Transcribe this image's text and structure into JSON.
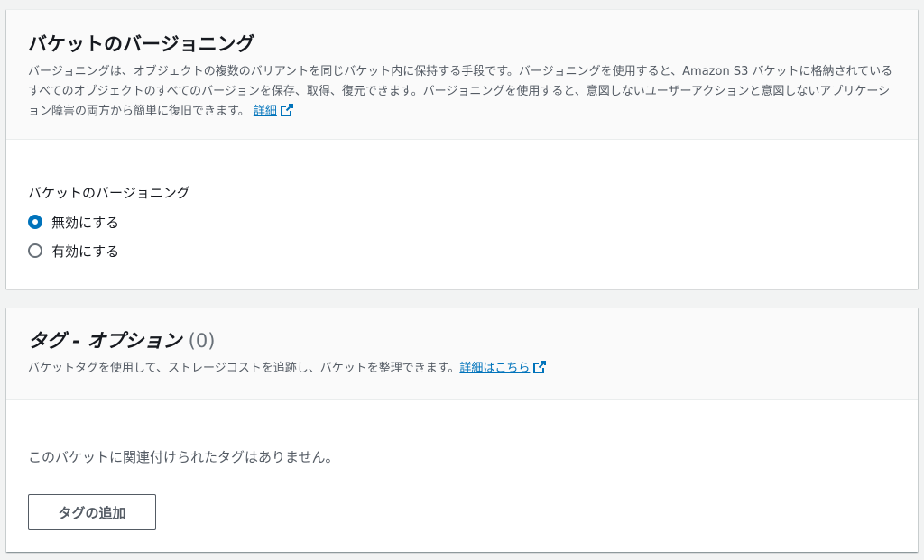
{
  "colors": {
    "link": "#0073bb",
    "radio_selected": "#0073bb",
    "page_background": "#f2f3f3",
    "header_background": "#fafafa"
  },
  "versioning": {
    "title": "バケットのバージョニング",
    "description": "バージョニングは、オブジェクトの複数のバリアントを同じバケット内に保持する手段です。バージョニングを使用すると、Amazon S3 バケットに格納されているすべてのオブジェクトのすべてのバージョンを保存、取得、復元できます。バージョニングを使用すると、意図しないユーザーアクションと意図しないアプリケーション障害の両方から簡単に復旧できます。",
    "learn_more": "詳細",
    "learn_more_icon": "external-link-icon",
    "field_label": "バケットのバージョニング",
    "options": [
      {
        "label": "無効にする",
        "selected": true
      },
      {
        "label": "有効にする",
        "selected": false
      }
    ]
  },
  "tags": {
    "title": "タグ - オプション",
    "count": "(0)",
    "description": "バケットタグを使用して、ストレージコストを追跡し、バケットを整理できます。",
    "learn_more": "詳細はこちら",
    "learn_more_icon": "external-link-icon",
    "empty_message": "このバケットに関連付けられたタグはありません。",
    "add_button": "タグの追加"
  }
}
